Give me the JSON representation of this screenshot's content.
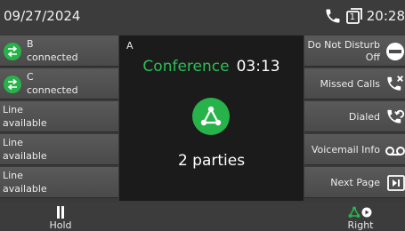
{
  "status_bar": {
    "date": "09/27/2024",
    "time": "20:28",
    "line_number": "1"
  },
  "left_keys": [
    {
      "line1": "B",
      "line2": "connected",
      "state": "connected"
    },
    {
      "line1": "C",
      "line2": "connected",
      "state": "connected"
    },
    {
      "line1": "Line",
      "line2": "available",
      "state": "available"
    },
    {
      "line1": "Line",
      "line2": "available",
      "state": "available"
    },
    {
      "line1": "Line",
      "line2": "available",
      "state": "available"
    }
  ],
  "call": {
    "line_label": "A",
    "title": "Conference",
    "duration": "03:13",
    "parties": "2 parties"
  },
  "right_keys": [
    {
      "line1": "Do Not Disturb",
      "line2": "Off",
      "icon": "do-not-disturb-icon"
    },
    {
      "line1": "Missed Calls",
      "icon": "missed-calls-icon"
    },
    {
      "line1": "Dialed",
      "icon": "dialed-calls-icon"
    },
    {
      "line1": "Voicemail Info",
      "icon": "voicemail-icon"
    },
    {
      "line1": "Next Page",
      "icon": "next-page-icon"
    }
  ],
  "softkeys": {
    "hold": "Hold",
    "right": "Right"
  },
  "colors": {
    "accent_green": "#27b24a",
    "conference_text": "#2ebd55",
    "background": "#3a3a3a",
    "call_panel": "#1b1b1b"
  }
}
